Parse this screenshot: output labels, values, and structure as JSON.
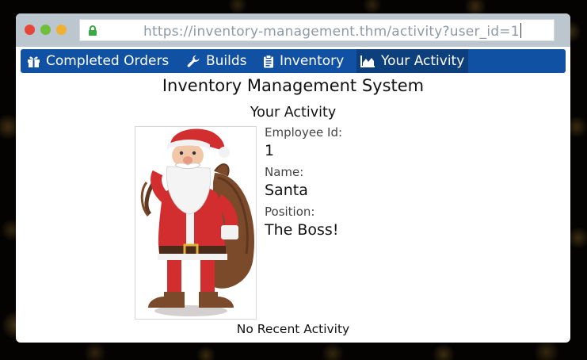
{
  "browser": {
    "url": "https://inventory-management.thm/activity?user_id=1"
  },
  "nav": {
    "items": [
      {
        "label": "Completed Orders",
        "icon": "gift-icon"
      },
      {
        "label": "Builds",
        "icon": "wrench-icon"
      },
      {
        "label": "Inventory",
        "icon": "clipboard-icon"
      },
      {
        "label": "Your Activity",
        "icon": "area-chart-icon",
        "active": true
      }
    ]
  },
  "page": {
    "title": "Inventory Management System",
    "section_title": "Your Activity"
  },
  "profile": {
    "employee_id_label": "Employee Id:",
    "employee_id": "1",
    "name_label": "Name:",
    "name": "Santa",
    "position_label": "Position:",
    "position": "The Boss!"
  },
  "activity": {
    "empty_text": "No Recent Activity"
  },
  "colors": {
    "navbar": "#1151a3",
    "navbar_active": "#0e3f7d",
    "titlebar": "#bcc6cf"
  }
}
